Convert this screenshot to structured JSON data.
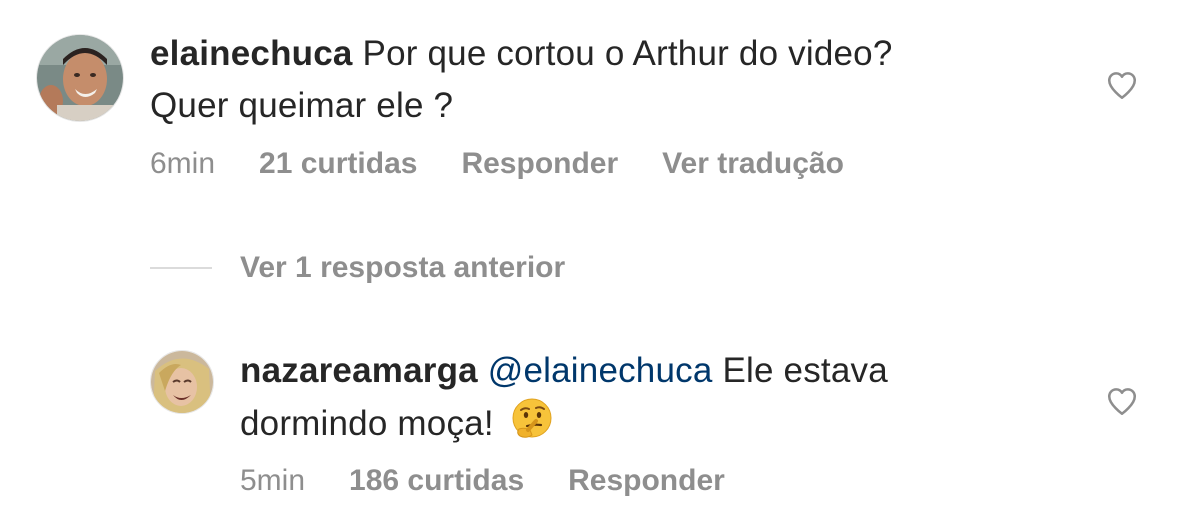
{
  "comments": [
    {
      "username": "elainechuca",
      "text_line1": " Por que cortou o Arthur do video?",
      "text_line2": "Quer queimar ele ?",
      "time": "6min",
      "likes": "21 curtidas",
      "reply": "Responder",
      "translate": "Ver tradução"
    },
    {
      "username": "nazareamarga",
      "mention": "@elainechuca",
      "text_line1": " Ele estava",
      "text_line2": "dormindo moça!",
      "emoji": "thinking-face",
      "time": "5min",
      "likes": "186 curtidas",
      "reply": "Responder"
    }
  ],
  "replies_toggle": {
    "label": "Ver 1 resposta anterior"
  },
  "colors": {
    "text": "#262626",
    "muted": "#8e8e8e",
    "mention": "#00376b",
    "divider": "#dbdbdb"
  }
}
